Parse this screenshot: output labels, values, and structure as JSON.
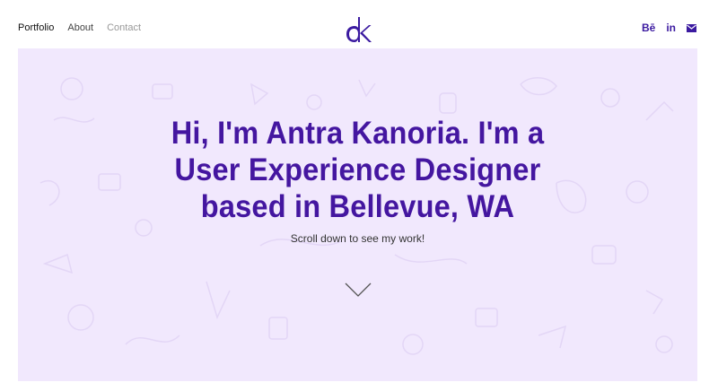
{
  "nav": {
    "portfolio": "Portfolio",
    "about": "About",
    "contact": "Contact"
  },
  "logo": {
    "text": "ak"
  },
  "social": {
    "behance": "Bē",
    "linkedin": "in"
  },
  "hero": {
    "headline_line1": "Hi, I'm Antra Kanoria. I'm a",
    "headline_line2": "User Experience Designer",
    "headline_line3": "based in Bellevue, WA",
    "subtitle": "Scroll down to see my work!"
  },
  "colors": {
    "accent": "#4416a0",
    "hero_bg": "#f1e8fd"
  },
  "icons": [
    "behance-icon",
    "linkedin-icon",
    "mail-icon",
    "chevron-down-icon"
  ]
}
